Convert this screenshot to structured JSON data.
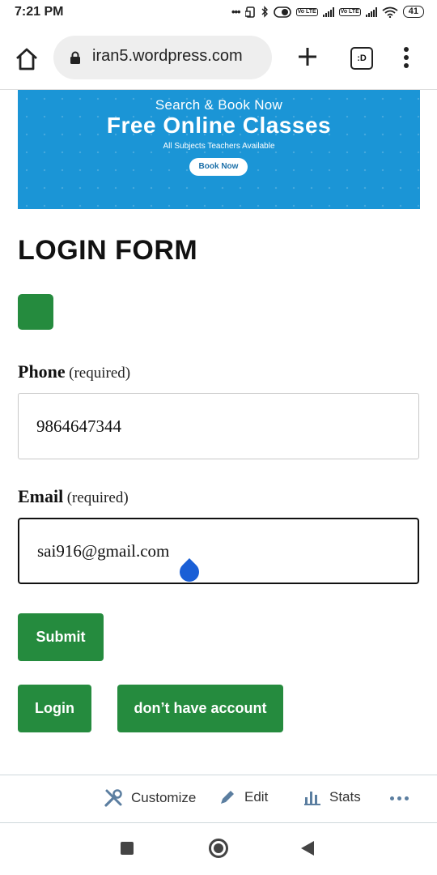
{
  "status_bar": {
    "time": "7:21 PM",
    "dots": "•••",
    "volte_1": "Vo LTE",
    "volte_2": "Vo LTE",
    "battery": "41"
  },
  "browser": {
    "url": "iran5.wordpress.com",
    "tabs_label": ":D"
  },
  "banner": {
    "line1": "Search & Book Now",
    "line2": "Free Online Classes",
    "line3": "All Subjects Teachers Available",
    "button_label": "Book Now"
  },
  "form": {
    "title": "LOGIN FORM",
    "phone": {
      "label": "Phone",
      "required": "(required)",
      "value": "9864647344"
    },
    "email": {
      "label": "Email",
      "required": "(required)",
      "value": "sai916@gmail.com"
    },
    "submit_label": "Submit",
    "login_label": "Login",
    "signup_label": "don’t have account"
  },
  "admin_bar": {
    "customize": "Customize",
    "edit": "Edit",
    "stats": "Stats"
  },
  "colors": {
    "accent_green": "#258b3e",
    "banner_blue": "#1b95d6",
    "cursor_blue": "#1a5fd6"
  }
}
